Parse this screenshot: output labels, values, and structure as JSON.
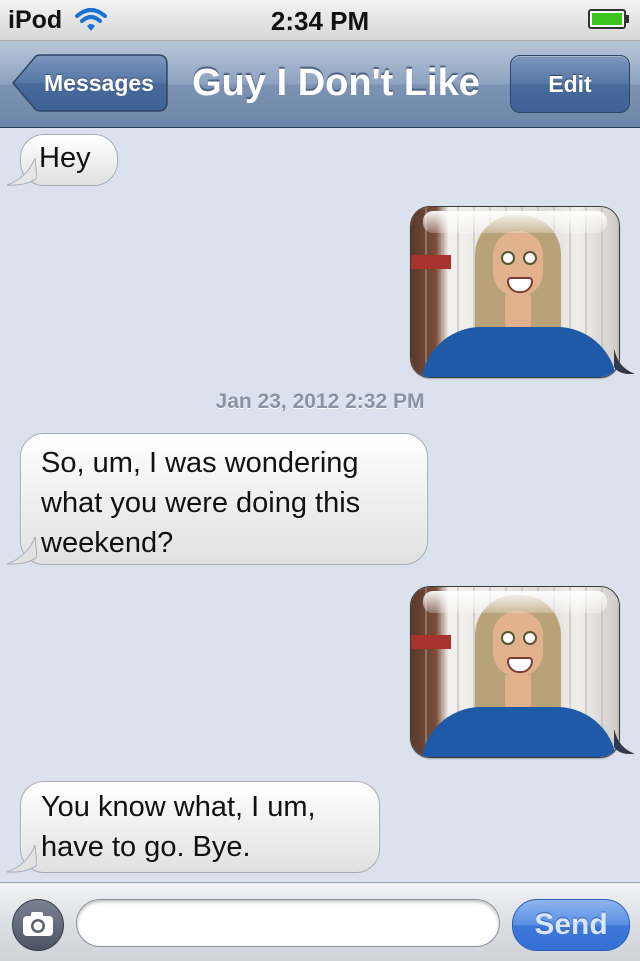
{
  "status_bar": {
    "carrier": "iPod",
    "time": "2:34 PM",
    "wifi_icon": "wifi-icon",
    "battery_icon": "battery-icon",
    "battery_color": "#3cc41e"
  },
  "nav": {
    "back_label": "Messages",
    "title": "Guy I Don't Like",
    "edit_label": "Edit"
  },
  "conversation": {
    "messages": [
      {
        "from": "them",
        "type": "text",
        "text": "Hey"
      },
      {
        "from": "me",
        "type": "photo"
      },
      {
        "from": "system",
        "type": "timestamp",
        "text": "Jan 23, 2012 2:32 PM"
      },
      {
        "from": "them",
        "type": "text",
        "lines": [
          "So, um, I was wondering",
          "what you were doing this",
          "weekend?"
        ]
      },
      {
        "from": "me",
        "type": "photo"
      },
      {
        "from": "them",
        "type": "text",
        "lines": [
          "You know what, I um,",
          "have to go. Bye."
        ]
      }
    ]
  },
  "composer": {
    "camera_icon": "camera-icon",
    "input_value": "",
    "send_label": "Send"
  },
  "colors": {
    "background": "#dbe2ed",
    "navbar": "#7d93b3",
    "send_button": "#3f78d8",
    "timestamp": "#8a93a3"
  }
}
